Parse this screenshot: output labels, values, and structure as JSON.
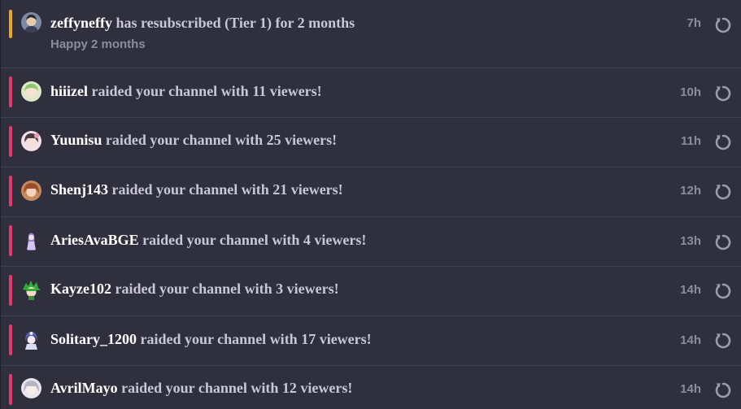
{
  "colors": {
    "resub_accent": "#e5a91b",
    "raid_accent": "#e4386f"
  },
  "events": [
    {
      "type": "resub",
      "username": "zeffyneffy",
      "message": " has resubscribed (Tier 1) for 2 months",
      "submessage": "Happy 2 months",
      "time": "7h",
      "avatar_icon": "avatar-dark-hair-icon"
    },
    {
      "type": "raid",
      "username": "hiiizel",
      "message": " raided your channel with 11 viewers!",
      "time": "10h",
      "avatar_icon": "avatar-green-hair-icon"
    },
    {
      "type": "raid",
      "username": "Yuunisu",
      "message": " raided your channel with 25 viewers!",
      "time": "11h",
      "avatar_icon": "avatar-pink-hair-icon"
    },
    {
      "type": "raid",
      "username": "Shenj143",
      "message": " raided your channel with 21 viewers!",
      "time": "12h",
      "avatar_icon": "avatar-brown-hair-icon"
    },
    {
      "type": "raid",
      "username": "AriesAvaBGE",
      "message": " raided your channel with 4 viewers!",
      "time": "13h",
      "avatar_icon": "avatar-purple-hair-icon"
    },
    {
      "type": "raid",
      "username": "Kayze102",
      "message": " raided your channel with 3 viewers!",
      "time": "14h",
      "avatar_icon": "avatar-green-spiky-hair-icon"
    },
    {
      "type": "raid",
      "username": "Solitary_1200",
      "message": " raided your channel with 17 viewers!",
      "time": "14h",
      "avatar_icon": "avatar-lavender-hair-icon"
    },
    {
      "type": "raid",
      "username": "AvrilMayo",
      "message": " raided your channel with 12 viewers!",
      "time": "14h",
      "avatar_icon": "avatar-silver-hair-icon"
    }
  ]
}
